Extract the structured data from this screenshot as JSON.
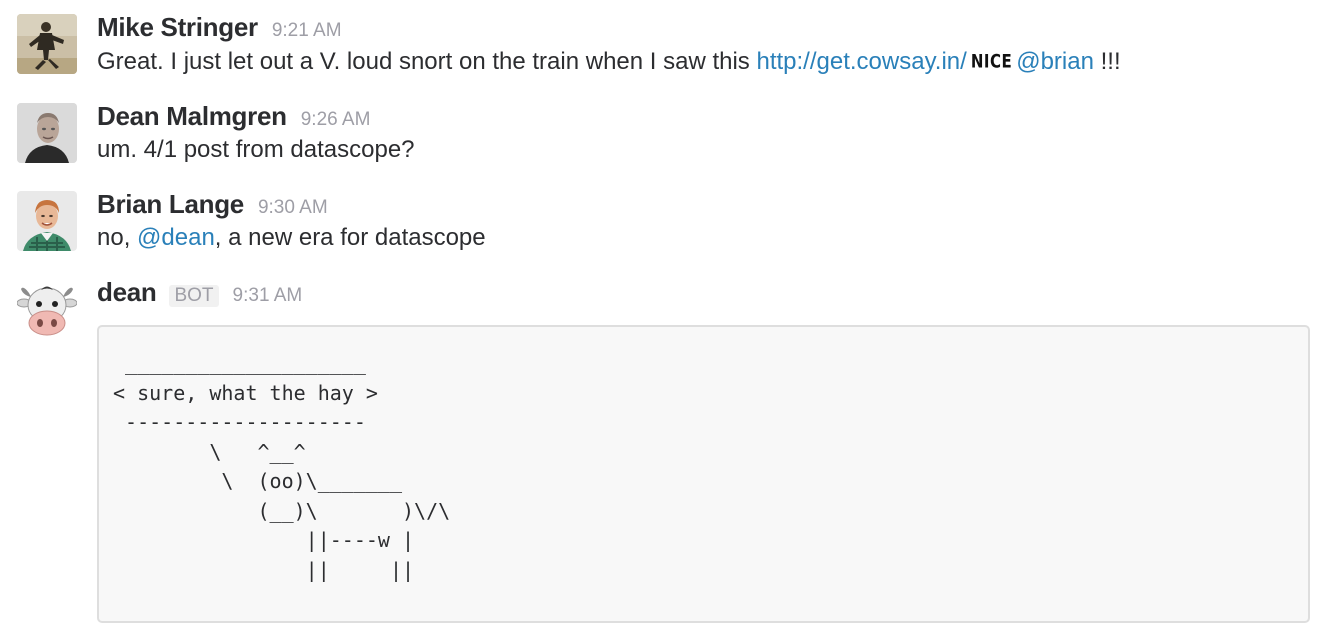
{
  "messages": [
    {
      "author": "Mike Stringer",
      "time": "9:21 AM",
      "avatar": "photo-avatar",
      "text_before_link": "Great. I just let out a V. loud snort on the train when I saw this ",
      "link": "http://get.cowsay.in/",
      "emoji": "NICE",
      "mention": "@brian",
      "text_after_mention": " !!!"
    },
    {
      "author": "Dean Malmgren",
      "time": "9:26 AM",
      "avatar": "photo-avatar",
      "text": "um. 4/1 post from datascope?"
    },
    {
      "author": "Brian Lange",
      "time": "9:30 AM",
      "avatar": "photo-avatar",
      "text_before_mention": "no, ",
      "mention": "@dean",
      "text_after_mention": ", a new era for datascope"
    },
    {
      "author": "dean",
      "badge": "BOT",
      "time": "9:31 AM",
      "avatar": "cow-face-icon",
      "snippet": " ____________________\n< sure, what the hay >\n --------------------\n        \\   ^__^\n         \\  (oo)\\_______\n            (__)\\       )\\/\\\n                ||----w |\n                ||     ||"
    }
  ],
  "colors": {
    "link": "#2a80b9",
    "timestamp": "#9e9ea6",
    "text": "#2c2d30",
    "snippet_bg": "#f8f8f8",
    "snippet_border": "#dedede"
  }
}
